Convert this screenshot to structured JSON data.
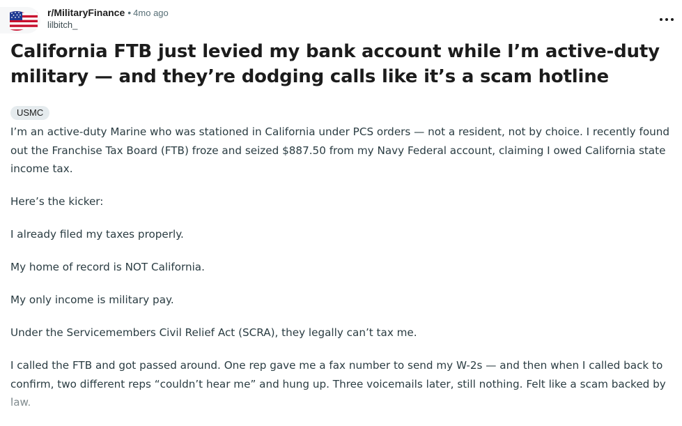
{
  "post": {
    "subreddit": "r/MilitaryFinance",
    "separator": "•",
    "time_ago": "4mo ago",
    "author": "lilbitch_",
    "avatar_icon": "american-flag-icon",
    "menu_icon": "more-options-icon",
    "title": "California FTB just levied my bank account while I’m active-duty military — and they’re dodging calls like it’s a scam hotline",
    "flair": "USMC",
    "paragraphs": [
      "I’m an active-duty Marine who was stationed in California under PCS orders — not a resident, not by choice. I recently found out the Franchise Tax Board (FTB) froze and seized $887.50 from my Navy Federal account, claiming I owed California state income tax.",
      "Here’s the kicker:",
      "I already filed my taxes properly.",
      "My home of record is NOT California.",
      "My only income is military pay.",
      "Under the Servicemembers Civil Relief Act (SCRA), they legally can’t tax me.",
      "I called the FTB and got passed around. One rep gave me a fax number to send my W-2s — and then when I called back to confirm, two different reps “couldn’t hear me” and hung up. Three voicemails later, still nothing. Felt like a scam backed by law."
    ]
  },
  "colors": {
    "text": "#1c1c1c",
    "body_text": "#2a3c42",
    "meta_text": "#576f76",
    "flair_bg": "#e5ebee",
    "flag_red": "#c8102e",
    "flag_blue": "#1f3a93"
  }
}
